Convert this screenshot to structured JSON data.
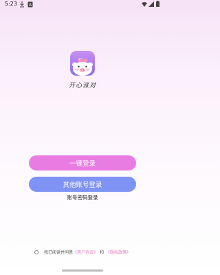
{
  "status_bar": {
    "time": "5:23",
    "icons_left": [
      "download-icon",
      "notification-icon"
    ],
    "icons_right": [
      "wifi-icon",
      "signal-icon",
      "battery-icon"
    ]
  },
  "app": {
    "name": "开心派对",
    "logo_icon": "pig-heart-logo-icon"
  },
  "buttons": {
    "one_click_login": "一键登录",
    "other_account_login": "其他账号登录",
    "password_login": "账号密码登录"
  },
  "agreement": {
    "prefix": "我已阅读并同意",
    "user_agreement": "《用户协议》",
    "conjunction": "和",
    "privacy_policy": "《隐私政策》",
    "checked": false
  },
  "colors": {
    "primary_button": "#e87ce2",
    "secondary_button": "#7f93f4",
    "link": "#e27fc0"
  }
}
